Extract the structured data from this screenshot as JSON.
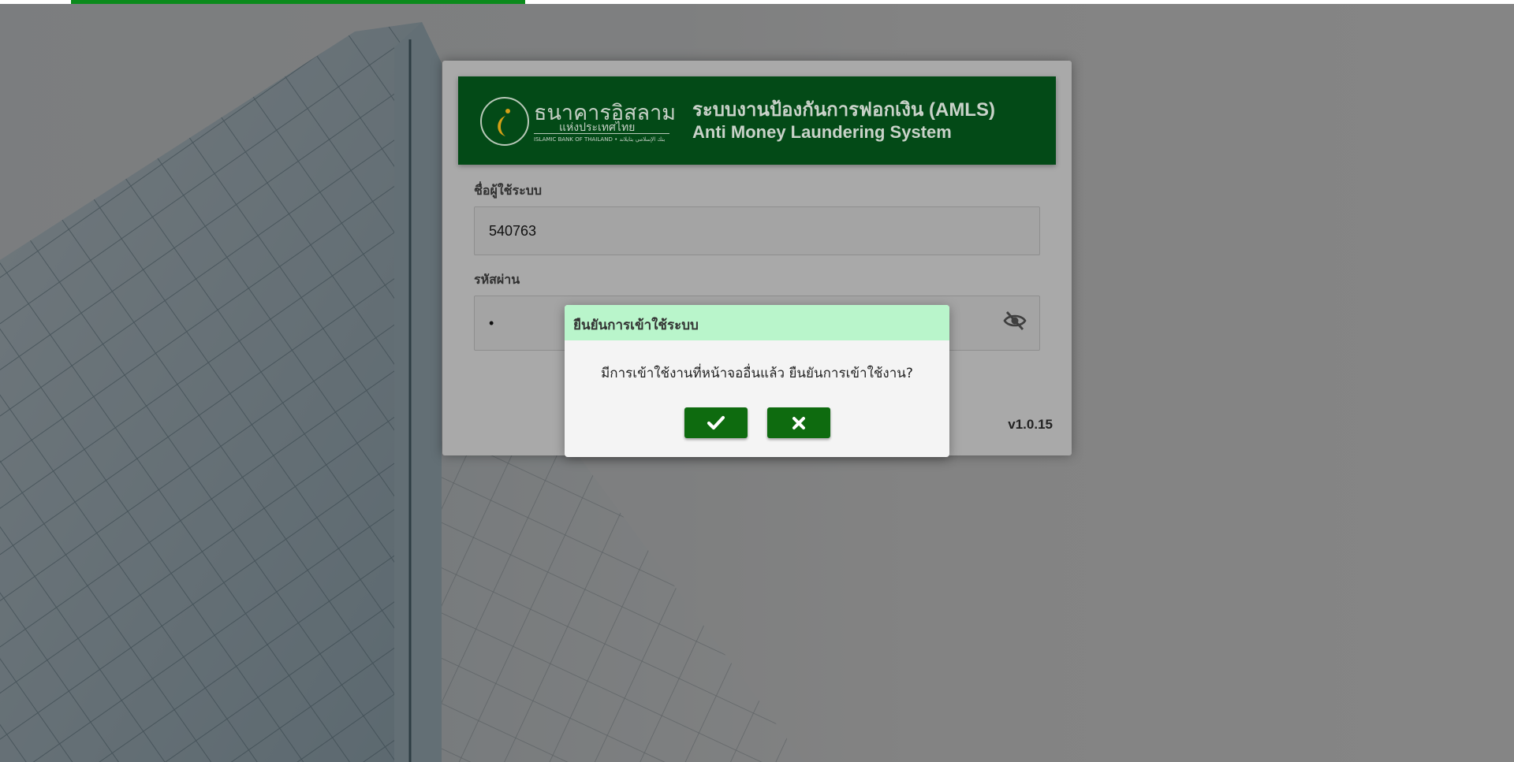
{
  "loading_bar": {
    "progress": 0.3
  },
  "banner": {
    "bank_name_th": "ธนาคารอิสลาม",
    "bank_subtitle_th": "แห่งประเทศไทย",
    "bank_name_en": "ISLAMIC BANK OF THAILAND  •  بنك الإسلامي بتايلاند",
    "system_title_th": "ระบบงานป้องกันการฟอกเงิน (AMLS)",
    "system_title_en": "Anti Money Laundering System"
  },
  "login": {
    "username_label": "ชื่อผู้ใช้ระบบ",
    "username_value": "540763",
    "password_label": "รหัสผ่าน",
    "password_value": "•",
    "version": "v1.0.15"
  },
  "icons": {
    "password_toggle": "eye-slash-icon",
    "confirm": "check-icon",
    "cancel": "close-icon"
  },
  "modal": {
    "title": "ยืนยันการเข้าใช้ระบบ",
    "message": "มีการเข้าใช้งานที่หน้าจออื่นแล้ว ยืนยันการเข้าใช้งาน?"
  },
  "colors": {
    "banner_green": "#034a17",
    "modal_header": "#b9f5cb",
    "button_green": "#0e6b0f",
    "progress_green": "#0b8a1c"
  }
}
